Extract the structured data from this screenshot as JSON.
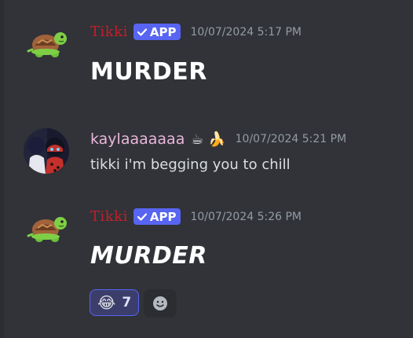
{
  "messages": [
    {
      "username": "Tikki",
      "badge": "APP",
      "timestamp": "10/07/2024 5:17 PM",
      "content": "MURDER"
    },
    {
      "username": "kaylaaaaaaa",
      "name_emojis": "☕ 🍌",
      "timestamp": "10/07/2024 5:21 PM",
      "content": "tikki i'm begging you to chill"
    },
    {
      "username": "Tikki",
      "badge": "APP",
      "timestamp": "10/07/2024 5:26 PM",
      "content": "MURDER",
      "reactions": [
        {
          "emoji": "😂",
          "count": "7"
        }
      ]
    }
  ],
  "colors": {
    "background": "#313338",
    "bot_name": "#c21f2b",
    "user_name": "#e9b6dc",
    "badge": "#5865f2",
    "timestamp": "#949ba4"
  },
  "icons": {
    "bot_avatar": "turtle-icon",
    "badge_check": "checkmark-icon",
    "add_reaction": "smiley-add-reaction-icon"
  }
}
